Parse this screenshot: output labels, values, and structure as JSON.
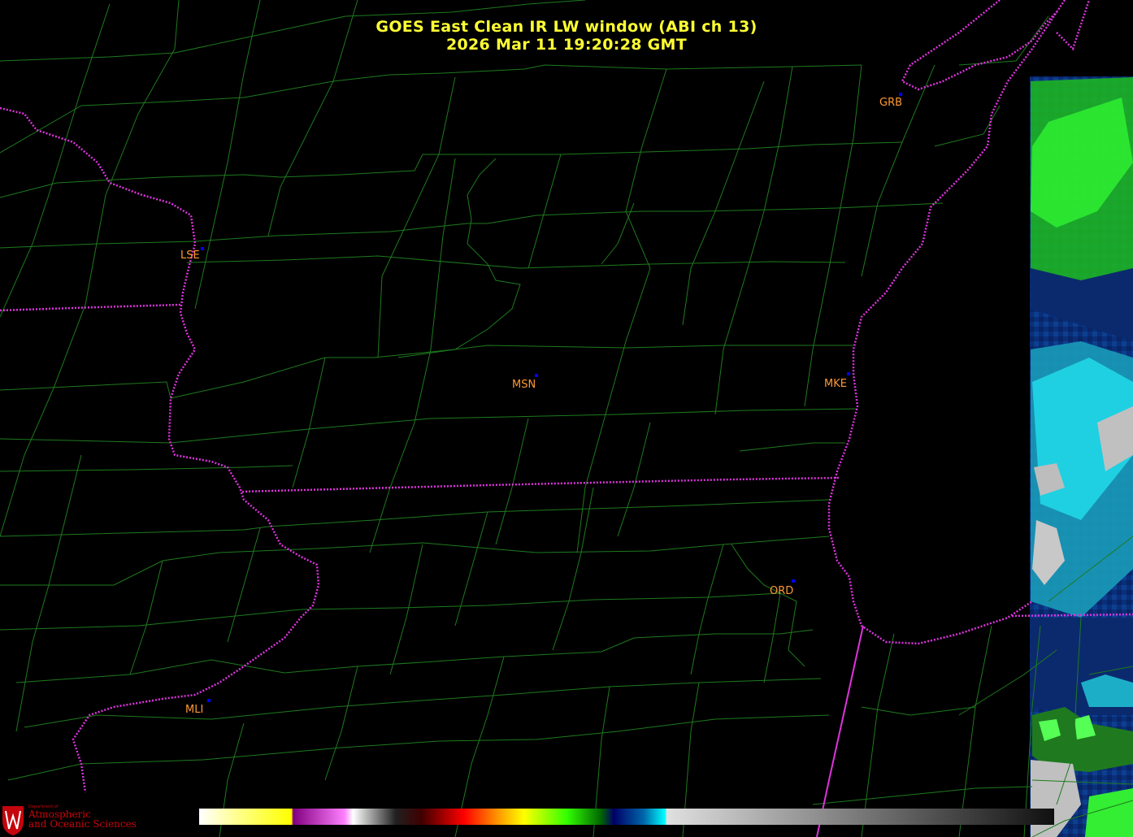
{
  "title": {
    "line1": "GOES East Clean IR LW window (ABI ch 13)",
    "line2": "2026 Mar 11  19:20:28 GMT"
  },
  "stations": [
    {
      "id": "GRB",
      "label": "GRB"
    },
    {
      "id": "LSE",
      "label": "LSE"
    },
    {
      "id": "MSN",
      "label": "MSN"
    },
    {
      "id": "MKE",
      "label": "MKE"
    },
    {
      "id": "ORD",
      "label": "ORD"
    },
    {
      "id": "MLI",
      "label": "MLI"
    }
  ],
  "logo": {
    "dept": "Department of",
    "line1": "Atmospheric",
    "line2": "and Oceanic Sciences"
  },
  "colors": {
    "title": "#ffff33",
    "station_label": "#ff9933",
    "station_marker": "#0000ff",
    "state_border": "#dd33dd",
    "county_border": "#1e7a1e",
    "logo": "#c5050c"
  },
  "colorbar_icon": "ir-temperature-colorbar"
}
